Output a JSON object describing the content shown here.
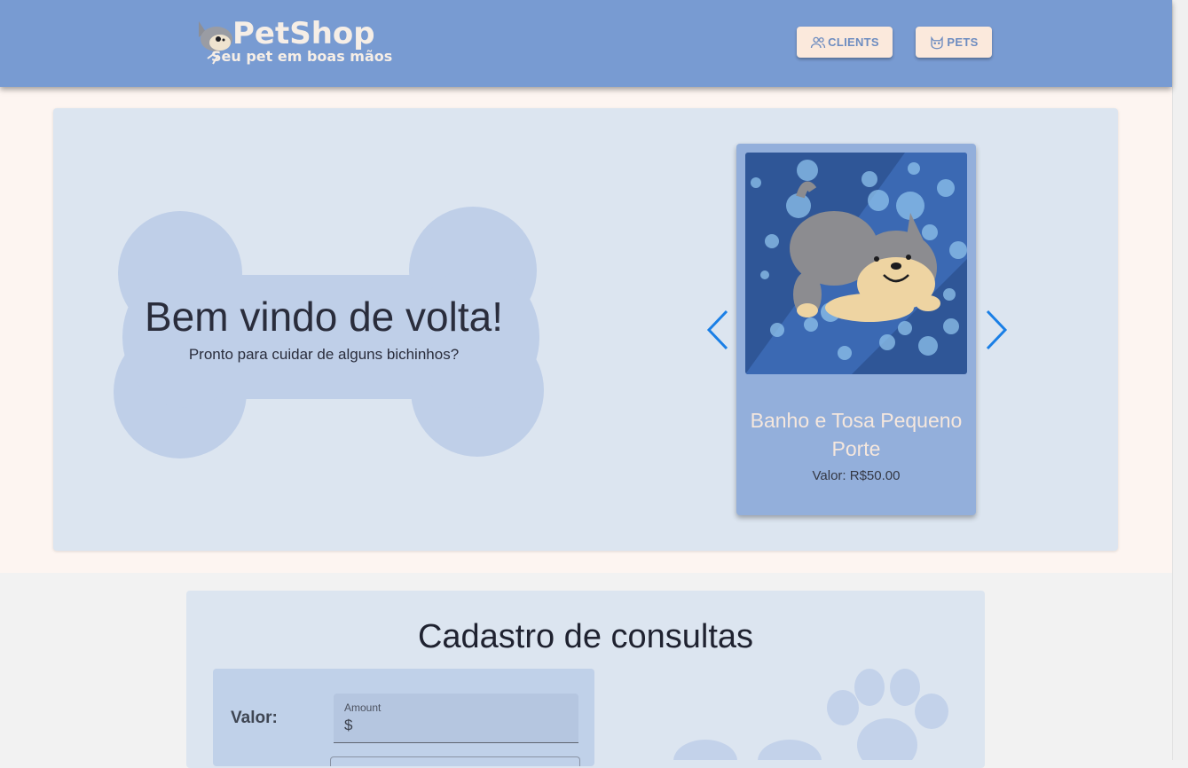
{
  "header": {
    "logo_title": "PetShop",
    "logo_subtitle": "Seu pet em boas mãos",
    "nav": [
      {
        "label": "CLIENTS",
        "icon": "users-icon"
      },
      {
        "label": "PETS",
        "icon": "cat-icon"
      }
    ]
  },
  "hero": {
    "welcome_title": "Bem vindo de volta!",
    "welcome_subtitle": "Pronto para cuidar de alguns bichinhos?",
    "carousel": {
      "service_name": "Banho e Tosa Pequeno Porte",
      "price_text": "Valor: R$50.00"
    }
  },
  "form": {
    "title": "Cadastro de consultas",
    "valor_label": "Valor:",
    "amount_label": "Amount",
    "amount_prefix": "$",
    "amount_value": ""
  },
  "colors": {
    "header": "#789bd2",
    "button_bg": "#fbe9dc",
    "card_bg": "#dce5f0",
    "service_card": "#93afdb",
    "arrow": "#1a7fe6"
  }
}
